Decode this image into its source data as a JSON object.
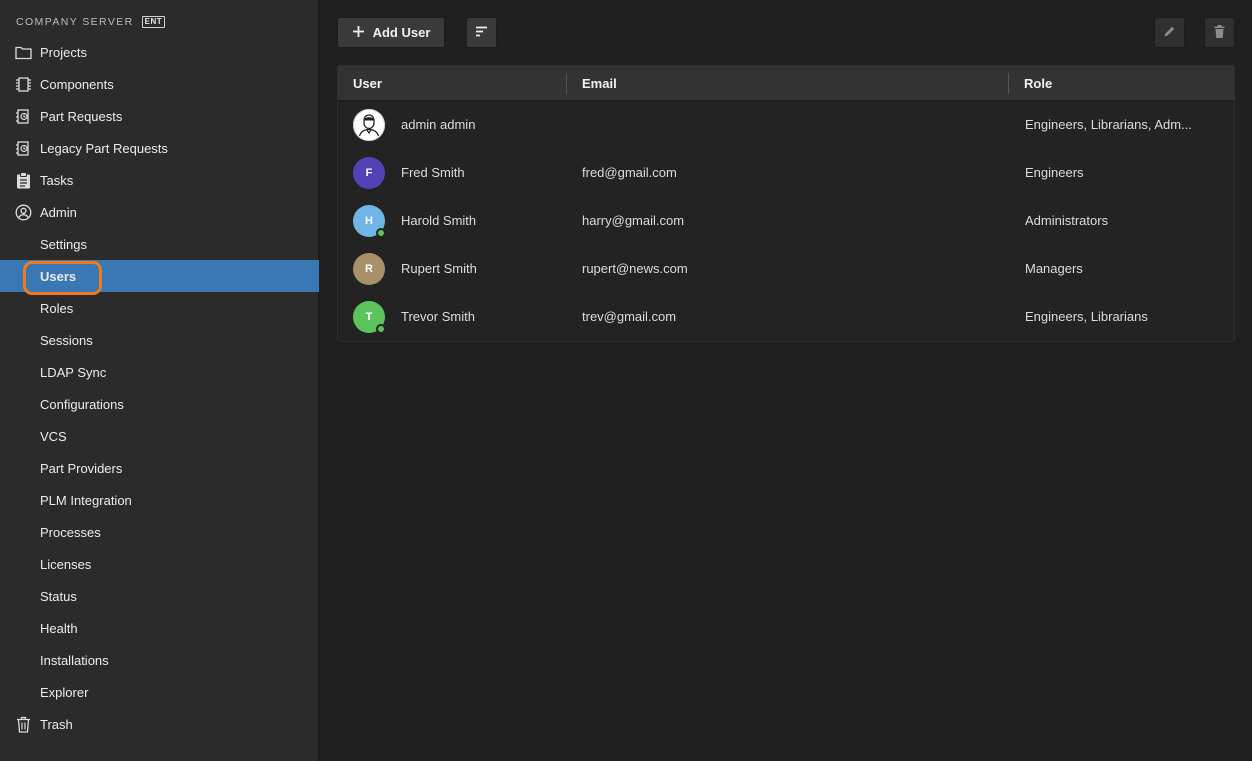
{
  "brand": {
    "title": "COMPANY SERVER",
    "badge": "ENT"
  },
  "sidebar": {
    "items": [
      {
        "label": "Projects",
        "icon": "folder-icon"
      },
      {
        "label": "Components",
        "icon": "chip-icon"
      },
      {
        "label": "Part Requests",
        "icon": "part-request-icon"
      },
      {
        "label": "Legacy Part Requests",
        "icon": "part-request-icon"
      },
      {
        "label": "Tasks",
        "icon": "clipboard-icon"
      },
      {
        "label": "Admin",
        "icon": "user-circle-icon"
      },
      {
        "label": "Settings"
      },
      {
        "label": "Users",
        "active": true
      },
      {
        "label": "Roles"
      },
      {
        "label": "Sessions"
      },
      {
        "label": "LDAP Sync"
      },
      {
        "label": "Configurations"
      },
      {
        "label": "VCS"
      },
      {
        "label": "Part Providers"
      },
      {
        "label": "PLM Integration"
      },
      {
        "label": "Processes"
      },
      {
        "label": "Licenses"
      },
      {
        "label": "Status"
      },
      {
        "label": "Health"
      },
      {
        "label": "Installations"
      },
      {
        "label": "Explorer"
      },
      {
        "label": "Trash",
        "icon": "trash-icon"
      }
    ]
  },
  "toolbar": {
    "add_label": "Add User"
  },
  "table": {
    "headers": {
      "user": "User",
      "email": "Email",
      "role": "Role"
    },
    "rows": [
      {
        "initial": "",
        "name": "admin admin",
        "email": "",
        "role": "Engineers, Librarians, Adm...",
        "avatar_color": "#ffffff",
        "online": false
      },
      {
        "initial": "F",
        "name": "Fred Smith",
        "email": "fred@gmail.com",
        "role": "Engineers",
        "avatar_color": "#5142b5",
        "online": false
      },
      {
        "initial": "H",
        "name": "Harold Smith",
        "email": "harry@gmail.com",
        "role": "Administrators",
        "avatar_color": "#6fb6e6",
        "online": true
      },
      {
        "initial": "R",
        "name": "Rupert Smith",
        "email": "rupert@news.com",
        "role": "Managers",
        "avatar_color": "#a8906a",
        "online": false
      },
      {
        "initial": "T",
        "name": "Trevor Smith",
        "email": "trev@gmail.com",
        "role": "Engineers, Librarians",
        "avatar_color": "#5cc45c",
        "online": true
      }
    ]
  },
  "colors": {
    "active": "#3a78b5",
    "highlight": "#f07a1f"
  }
}
